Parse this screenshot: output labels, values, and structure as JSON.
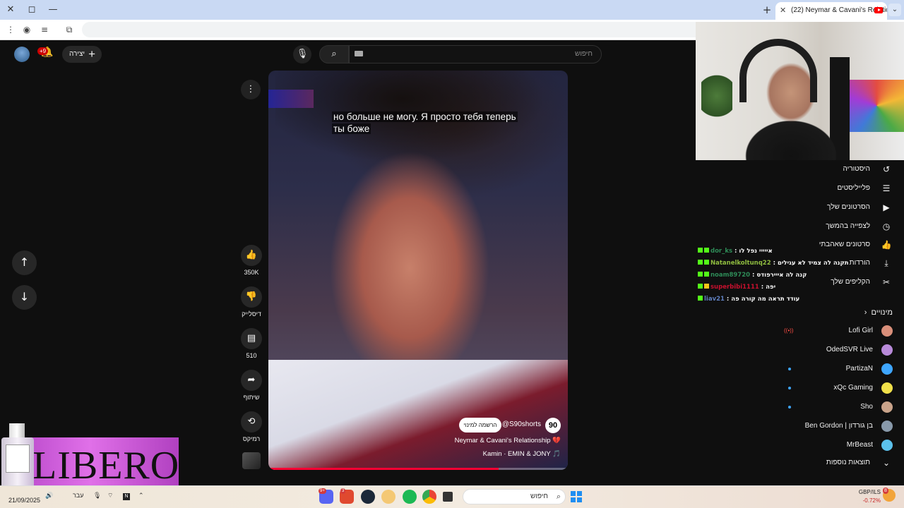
{
  "browser": {
    "tab_title": "(22) Neymar & Cavani's Relatio",
    "close_icon": "✕",
    "restore_icon": "◻",
    "minimize_icon": "—",
    "new_tab_icon": "+",
    "tab_menu_icon": "⌄"
  },
  "header": {
    "create_label": "יצירה",
    "notifications_badge": "+9",
    "search_placeholder": "חיפוש"
  },
  "video": {
    "caption_line1": "но больше не могу. Я просто тебя теперь",
    "caption_line2": "ты боже",
    "channel_logo": "90",
    "channel_name": "@S90shorts",
    "subscribe_label": "הרשמה למינוי",
    "title": "Neymar & Cavani's Relationship 💔",
    "music": "Kamin · EMIN & JONY 🎵",
    "progress": 0.77
  },
  "actions": {
    "likes": "350K",
    "dislike_label": "דיסלייק",
    "comments": "510",
    "share_label": "שיתוף",
    "remix_label": "רמיקס"
  },
  "sidebar": {
    "items": [
      {
        "label": "היסטוריה",
        "icon": "history-icon",
        "glyph": "↺"
      },
      {
        "label": "פלייליסטים",
        "icon": "playlist-icon",
        "glyph": "☰"
      },
      {
        "label": "הסרטונים שלך",
        "icon": "your-videos-icon",
        "glyph": "▶"
      },
      {
        "label": "לצפייה בהמשך",
        "icon": "watch-later-icon",
        "glyph": "◷"
      },
      {
        "label": "סרטונים שאהבתי",
        "icon": "liked-icon",
        "glyph": "👍"
      },
      {
        "label": "הורדות",
        "icon": "download-icon",
        "glyph": "⤓"
      },
      {
        "label": "הקליפים שלך",
        "icon": "clips-icon",
        "glyph": "✂"
      }
    ],
    "subscriptions_header": "מינויים",
    "subscriptions": [
      {
        "name": "Lofi Girl",
        "color": "#d98f7a",
        "indicator": "live"
      },
      {
        "name": "OdedSVR Live",
        "color": "#b88ad9",
        "indicator": ""
      },
      {
        "name": "PartizaN",
        "color": "#3ea6ff",
        "indicator": "dot"
      },
      {
        "name": "xQc Gaming",
        "color": "#f0e04a",
        "indicator": "dot"
      },
      {
        "name": "Sho",
        "color": "#c9a38a",
        "indicator": "dot"
      },
      {
        "name": "Ben Gordon | בן גורדון",
        "color": "#8899aa",
        "indicator": ""
      },
      {
        "name": "MrBeast",
        "color": "#5bc0eb",
        "indicator": ""
      }
    ],
    "show_more": "תוצאות נוספות"
  },
  "chat": [
    {
      "user": "dor_ks",
      "user_color": "#2e8b57",
      "message": "אייייי נפל לו"
    },
    {
      "user": "Natanelkoltunq22",
      "user_color": "#8fbc3f",
      "message": "תקנה לה צמיד לא עגילים"
    },
    {
      "user": "noam89720",
      "user_color": "#2e8b57",
      "message": "קנה לה אייירפודס"
    },
    {
      "user": "superbibi1111",
      "user_color": "#c8102e",
      "message": "יפה"
    },
    {
      "user": "liav21",
      "user_color": "#5f7fbf",
      "message": "עודד תראה מה קורה פה"
    }
  ],
  "overlay": {
    "libero_text": "LIBERO"
  },
  "taskbar": {
    "search_placeholder": "חיפוש",
    "date": "21/09/2025",
    "language": "עבר",
    "fx_label": "GBP/ILS",
    "fx_change": "-0.72%",
    "notification_count": "8",
    "discord_badge": "9+",
    "app_badge": "3"
  },
  "colors": {
    "accent_red": "#ff0033",
    "background": "#0f0f0f"
  }
}
